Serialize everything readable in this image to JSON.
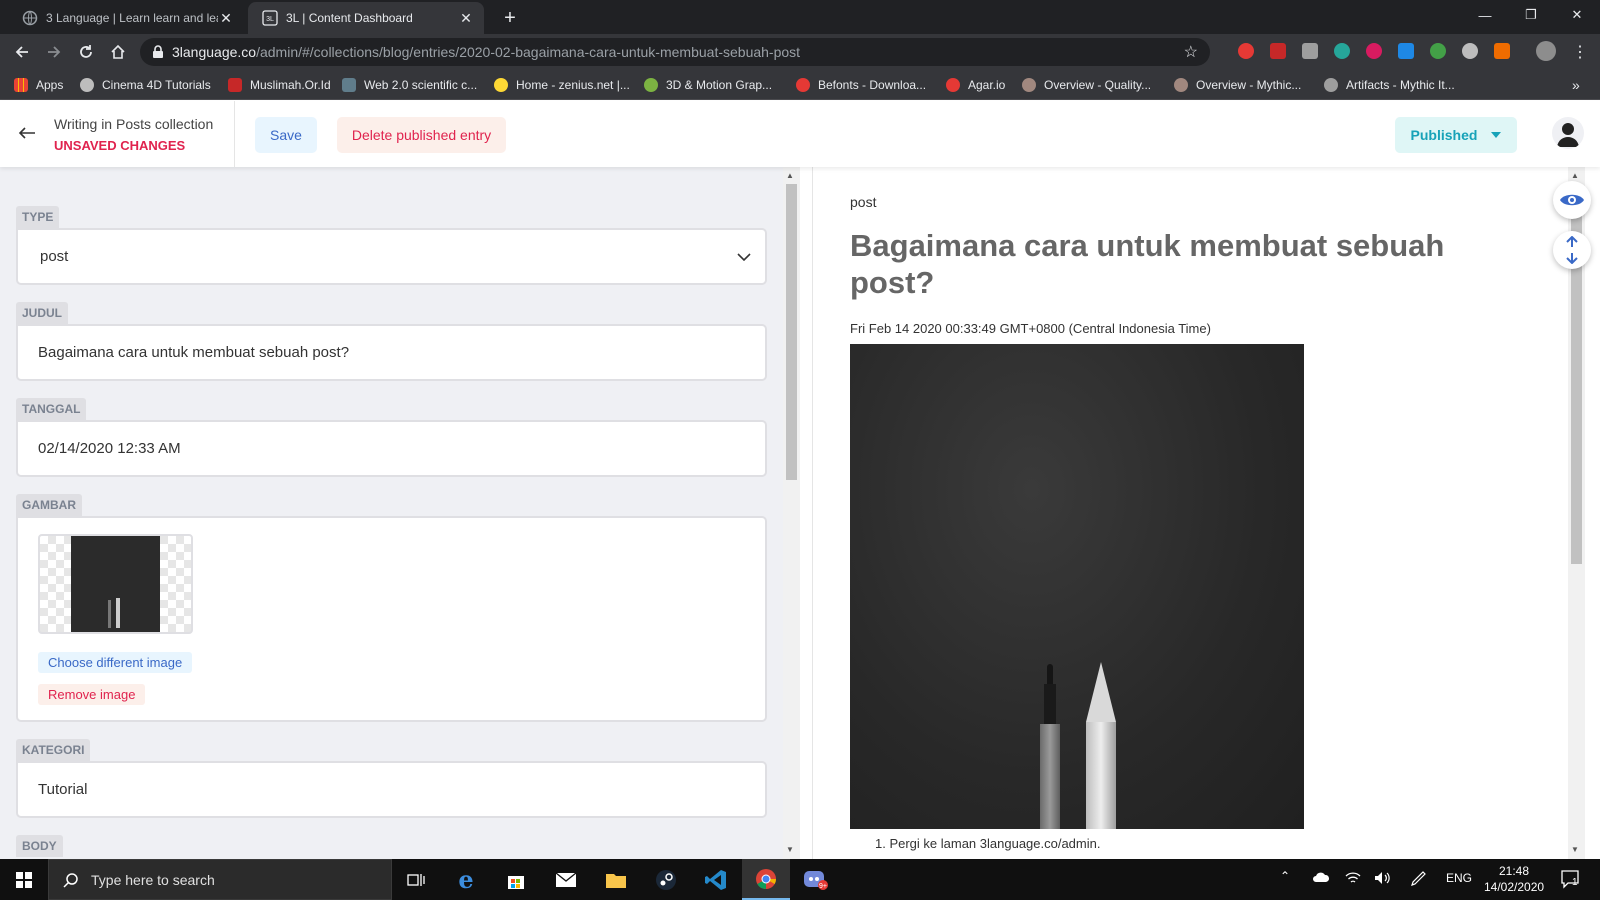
{
  "browser": {
    "tabs": [
      {
        "title": "3 Language | Learn learn and lear",
        "active": false
      },
      {
        "title": "3L | Content Dashboard",
        "active": true
      }
    ],
    "url_host": "3language.co",
    "url_path": "/admin/#/collections/blog/entries/2020-02-bagaimana-cara-untuk-membuat-sebuah-post",
    "bookmarks": [
      "Apps",
      "Cinema 4D Tutorials",
      "Muslimah.Or.Id",
      "Web 2.0 scientific c...",
      "Home - zenius.net |...",
      "3D & Motion Grap...",
      "Befonts - Downloa...",
      "Agar.io",
      "Overview - Quality...",
      "Overview - Mythic...",
      "Artifacts - Mythic It..."
    ]
  },
  "cms": {
    "writing_in": "Writing in Posts collection",
    "status": "UNSAVED CHANGES",
    "save_label": "Save",
    "delete_label": "Delete published entry",
    "publish_state": "Published"
  },
  "fields": {
    "type": {
      "label": "TYPE",
      "value": "post"
    },
    "judul": {
      "label": "JUDUL",
      "value": "Bagaimana cara untuk membuat sebuah post?"
    },
    "tanggal": {
      "label": "TANGGAL",
      "value": "02/14/2020 12:33 AM"
    },
    "gambar": {
      "label": "GAMBAR",
      "choose_label": "Choose different image",
      "remove_label": "Remove image"
    },
    "kategori": {
      "label": "KATEGORI",
      "value": "Tutorial"
    },
    "body": {
      "label": "BODY"
    }
  },
  "preview": {
    "type": "post",
    "title": "Bagaimana cara untuk membuat sebuah post?",
    "date": "Fri Feb 14 2020 00:33:49 GMT+0800 (Central Indonesia Time)",
    "list_item": "1. Pergi ke laman 3language.co/admin."
  },
  "taskbar": {
    "search_placeholder": "Type here to search",
    "lang": "ENG",
    "time": "21:48",
    "date": "14/02/2020",
    "notification_count": "1"
  },
  "colors": {
    "accent_blue": "#3a69c7",
    "danger_red": "#e0234e",
    "publish_teal": "#17a2b8"
  }
}
